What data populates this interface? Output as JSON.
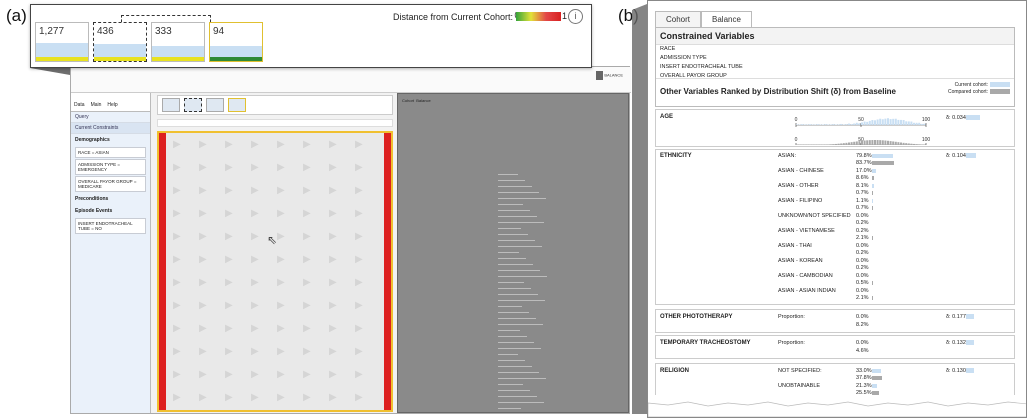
{
  "labels": {
    "a": "(a)",
    "b": "(b)"
  },
  "zoom": {
    "distance_label": "Distance from Current Cohort:",
    "gradient_min": "0",
    "gradient_max": "1",
    "info": "i",
    "boxes": [
      {
        "count": "1,277",
        "fill": 0.55,
        "accent": "#e8e220",
        "selected": false
      },
      {
        "count": "436",
        "fill": 0.5,
        "accent": "#e8e220",
        "selected": true
      },
      {
        "count": "333",
        "fill": 0.3,
        "accent": "#e8e220",
        "selected": false
      },
      {
        "count": "94",
        "fill": 0.25,
        "accent": "#2f8a35",
        "selected": false
      }
    ]
  },
  "app": {
    "tabs": [
      "Data",
      "Main",
      "Help"
    ],
    "query_label": "Query",
    "current_constraints": "Current Constraints",
    "demographics": "Demographics",
    "race_card": "RACE = ASIAN",
    "admission_card": "ADMISSION TYPE = EMERGENCY",
    "payor_card": "OVERALL PAYOR GROUP = MEDICARE",
    "preconditions": "Preconditions",
    "episode_events": "Episode Events",
    "episode_card": "INSERT ENDOTRACHEAL TUBE = NO",
    "balance_icon_label": "BALANCE"
  },
  "balance": {
    "tabs": [
      "Cohort",
      "Balance"
    ],
    "constrained_title": "Constrained Variables",
    "constrained": [
      "RACE",
      "ADMISSION TYPE",
      "INSERT ENDOTRACHEAL TUBE",
      "OVERALL PAYOR GROUP"
    ],
    "legend_current": "Current cohort:",
    "legend_compared": "Compared cohort:",
    "ranked_title": "Other Variables Ranked by Distribution Shift (δ) from Baseline",
    "age": {
      "name": "AGE",
      "delta": "δ: 0.034",
      "delta_fill": 0.3,
      "ticks": [
        "0",
        "50",
        "100"
      ]
    },
    "ethnicity": {
      "name": "ETHNICITY",
      "delta": "δ: 0.104",
      "delta_fill": 0.25,
      "rows": [
        {
          "label": "ASIAN:",
          "current": "79.8%",
          "compared": "83.7%",
          "cf": 0.8,
          "pf": 0.84
        },
        {
          "label": "ASIAN - CHINESE",
          "current": "17.0%",
          "compared": "8.6%",
          "cf": 0.17,
          "pf": 0.09
        },
        {
          "label": "ASIAN - OTHER",
          "current": "8.1%",
          "compared": "0.7%",
          "cf": 0.08,
          "pf": 0.01
        },
        {
          "label": "ASIAN - FILIPINO",
          "current": "1.1%",
          "compared": "0.7%",
          "cf": 0.01,
          "pf": 0.01
        },
        {
          "label": "UNKNOWN/NOT SPECIFIED",
          "current": "0.0%",
          "compared": "0.2%",
          "cf": 0,
          "pf": 0.002
        },
        {
          "label": "ASIAN - VIETNAMESE",
          "current": "0.2%",
          "compared": "2.1%",
          "cf": 0.002,
          "pf": 0.02
        },
        {
          "label": "ASIAN - THAI",
          "current": "0.0%",
          "compared": "0.2%",
          "cf": 0,
          "pf": 0.002
        },
        {
          "label": "ASIAN - KOREAN",
          "current": "0.0%",
          "compared": "0.2%",
          "cf": 0,
          "pf": 0.002
        },
        {
          "label": "ASIAN - CAMBODIAN",
          "current": "0.0%",
          "compared": "0.5%",
          "cf": 0,
          "pf": 0.005
        },
        {
          "label": "ASIAN - ASIAN INDIAN",
          "current": "0.0%",
          "compared": "2.1%",
          "cf": 0,
          "pf": 0.02
        }
      ]
    },
    "phototherapy": {
      "name": "OTHER PHOTOTHERAPY",
      "label": "Proportion:",
      "current": "0.0%",
      "compared": "8.2%",
      "delta": "δ: 0.177",
      "delta_fill": 0.2
    },
    "tracheostomy": {
      "name": "TEMPORARY TRACHEOSTOMY",
      "label": "Proportion:",
      "current": "0.0%",
      "compared": "4.6%",
      "delta": "δ: 0.132",
      "delta_fill": 0.18
    },
    "religion": {
      "name": "RELIGION",
      "delta": "δ: 0.130",
      "delta_fill": 0.18,
      "rows": [
        {
          "label": "NOT SPECIFIED:",
          "current": "33.0%",
          "compared": "37.8%",
          "cf": 0.33,
          "pf": 0.38
        },
        {
          "label": "UNOBTAINABLE",
          "current": "21.3%",
          "compared": "25.5%",
          "cf": 0.21,
          "pf": 0.25
        },
        {
          "label": "OTHER",
          "current": "14.9%",
          "compared": "",
          "cf": 0.15,
          "pf": 0
        }
      ]
    }
  }
}
